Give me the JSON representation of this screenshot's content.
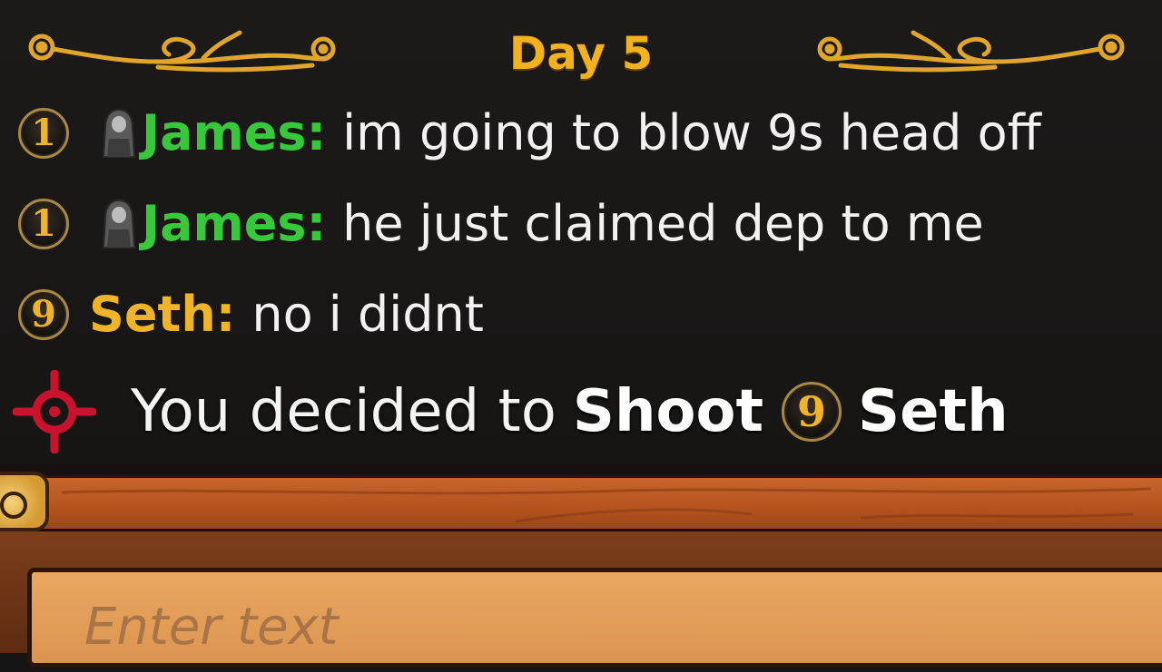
{
  "header": {
    "day_title": "Day 5"
  },
  "messages": [
    {
      "number": "1",
      "name": "James:",
      "text": "im going to blow 9s head off",
      "name_color": "#37c93b",
      "has_avatar": true,
      "avatar_icon": "hooded-figure-icon"
    },
    {
      "number": "1",
      "name": "James:",
      "text": "he just claimed dep to me",
      "name_color": "#37c93b",
      "has_avatar": true,
      "avatar_icon": "hooded-figure-icon"
    },
    {
      "number": "9",
      "name": "Seth:",
      "text": "no i didnt",
      "name_color": "#f0b42a",
      "has_avatar": false
    }
  ],
  "action": {
    "icon": "crosshair-icon",
    "text_prefix": "You decided to",
    "verb": "Shoot",
    "target_number": "9",
    "target_name": "Seth"
  },
  "input": {
    "placeholder": "Enter text"
  },
  "colors": {
    "accent_gold": "#f2b11e",
    "green_name": "#37c93b",
    "crosshair_red": "#c8122e",
    "wood": "#c5652c"
  }
}
